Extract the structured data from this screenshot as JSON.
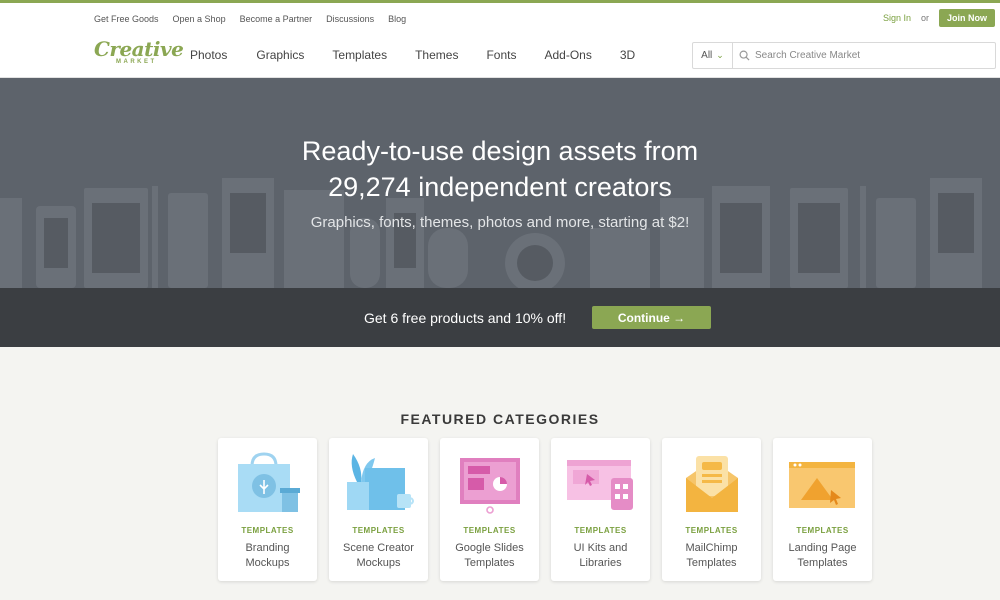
{
  "utility": {
    "links": [
      "Get Free Goods",
      "Open a Shop",
      "Become a Partner",
      "Discussions",
      "Blog"
    ],
    "sign_in": "Sign In",
    "or": "or",
    "join": "Join Now"
  },
  "logo": {
    "main": "Creative",
    "sub": "MARKET"
  },
  "nav": {
    "items": [
      "Photos",
      "Graphics",
      "Templates",
      "Themes",
      "Fonts",
      "Add-Ons",
      "3D"
    ]
  },
  "search": {
    "scope": "All",
    "placeholder": "Search Creative Market"
  },
  "hero": {
    "title_line1": "Ready-to-use design assets from",
    "title_line2": "29,274 independent creators",
    "subtitle": "Graphics, fonts, themes, photos and more, starting at $2!"
  },
  "promo": {
    "text": "Get 6 free products and 10% off!",
    "button": "Continue →"
  },
  "featured": {
    "title": "FEATURED CATEGORIES",
    "cards": [
      {
        "kicker": "TEMPLATES",
        "line1": "Branding",
        "line2": "Mockups",
        "icon": "shopping-bag-icon"
      },
      {
        "kicker": "TEMPLATES",
        "line1": "Scene Creator",
        "line2": "Mockups",
        "icon": "scene-plant-icon"
      },
      {
        "kicker": "TEMPLATES",
        "line1": "Google Slides",
        "line2": "Templates",
        "icon": "slides-screen-icon"
      },
      {
        "kicker": "TEMPLATES",
        "line1": "UI Kits and",
        "line2": "Libraries",
        "icon": "ui-kit-icon"
      },
      {
        "kicker": "TEMPLATES",
        "line1": "MailChimp",
        "line2": "Templates",
        "icon": "envelope-icon"
      },
      {
        "kicker": "TEMPLATES",
        "line1": "Landing Page",
        "line2": "Templates",
        "icon": "landing-page-icon"
      }
    ]
  },
  "colors": {
    "brand": "#8ba753",
    "hero_bg": "#5d636b",
    "promo_bg": "#3b3e42"
  }
}
